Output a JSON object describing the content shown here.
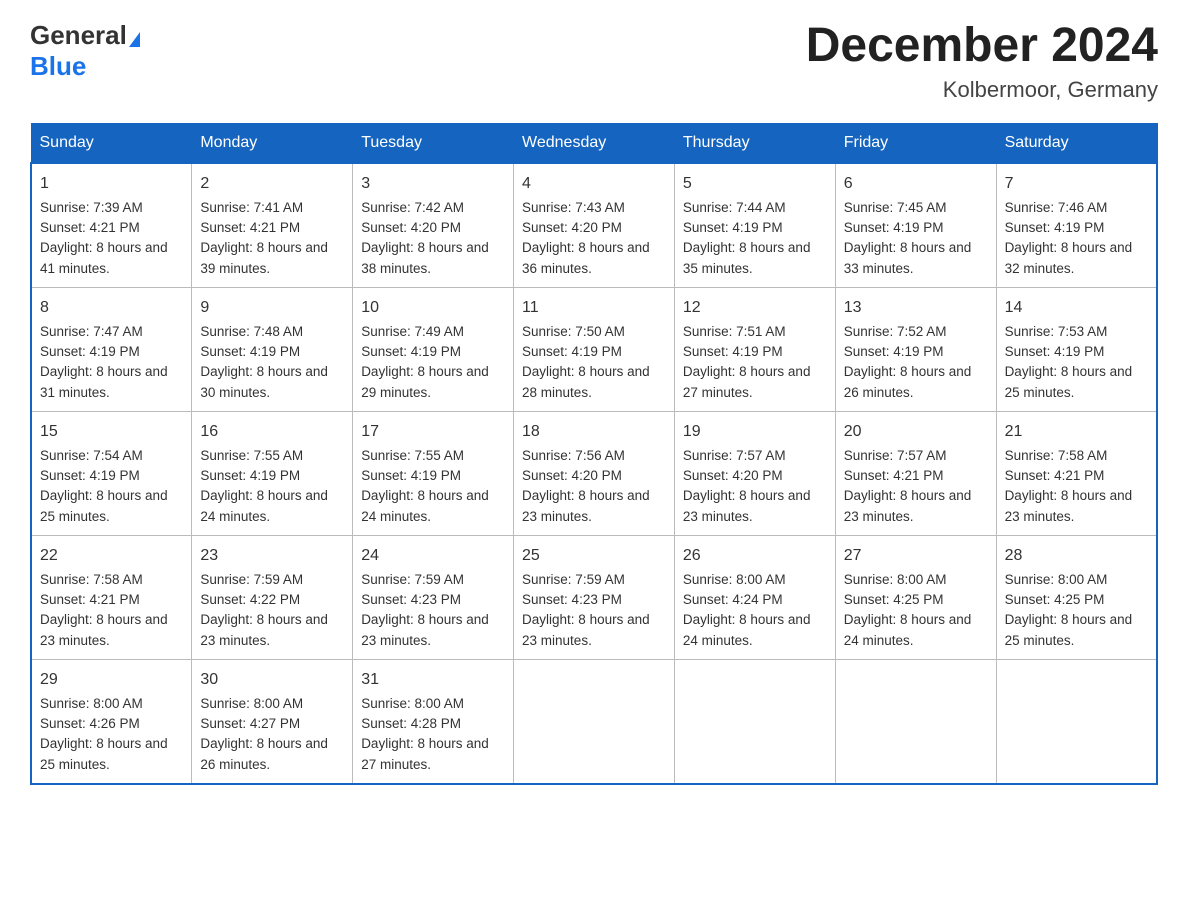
{
  "header": {
    "logo_general": "General",
    "logo_blue": "Blue",
    "title": "December 2024",
    "subtitle": "Kolbermoor, Germany"
  },
  "days_of_week": [
    "Sunday",
    "Monday",
    "Tuesday",
    "Wednesday",
    "Thursday",
    "Friday",
    "Saturday"
  ],
  "weeks": [
    [
      {
        "day": "1",
        "sunrise": "7:39 AM",
        "sunset": "4:21 PM",
        "daylight": "8 hours and 41 minutes."
      },
      {
        "day": "2",
        "sunrise": "7:41 AM",
        "sunset": "4:21 PM",
        "daylight": "8 hours and 39 minutes."
      },
      {
        "day": "3",
        "sunrise": "7:42 AM",
        "sunset": "4:20 PM",
        "daylight": "8 hours and 38 minutes."
      },
      {
        "day": "4",
        "sunrise": "7:43 AM",
        "sunset": "4:20 PM",
        "daylight": "8 hours and 36 minutes."
      },
      {
        "day": "5",
        "sunrise": "7:44 AM",
        "sunset": "4:19 PM",
        "daylight": "8 hours and 35 minutes."
      },
      {
        "day": "6",
        "sunrise": "7:45 AM",
        "sunset": "4:19 PM",
        "daylight": "8 hours and 33 minutes."
      },
      {
        "day": "7",
        "sunrise": "7:46 AM",
        "sunset": "4:19 PM",
        "daylight": "8 hours and 32 minutes."
      }
    ],
    [
      {
        "day": "8",
        "sunrise": "7:47 AM",
        "sunset": "4:19 PM",
        "daylight": "8 hours and 31 minutes."
      },
      {
        "day": "9",
        "sunrise": "7:48 AM",
        "sunset": "4:19 PM",
        "daylight": "8 hours and 30 minutes."
      },
      {
        "day": "10",
        "sunrise": "7:49 AM",
        "sunset": "4:19 PM",
        "daylight": "8 hours and 29 minutes."
      },
      {
        "day": "11",
        "sunrise": "7:50 AM",
        "sunset": "4:19 PM",
        "daylight": "8 hours and 28 minutes."
      },
      {
        "day": "12",
        "sunrise": "7:51 AM",
        "sunset": "4:19 PM",
        "daylight": "8 hours and 27 minutes."
      },
      {
        "day": "13",
        "sunrise": "7:52 AM",
        "sunset": "4:19 PM",
        "daylight": "8 hours and 26 minutes."
      },
      {
        "day": "14",
        "sunrise": "7:53 AM",
        "sunset": "4:19 PM",
        "daylight": "8 hours and 25 minutes."
      }
    ],
    [
      {
        "day": "15",
        "sunrise": "7:54 AM",
        "sunset": "4:19 PM",
        "daylight": "8 hours and 25 minutes."
      },
      {
        "day": "16",
        "sunrise": "7:55 AM",
        "sunset": "4:19 PM",
        "daylight": "8 hours and 24 minutes."
      },
      {
        "day": "17",
        "sunrise": "7:55 AM",
        "sunset": "4:19 PM",
        "daylight": "8 hours and 24 minutes."
      },
      {
        "day": "18",
        "sunrise": "7:56 AM",
        "sunset": "4:20 PM",
        "daylight": "8 hours and 23 minutes."
      },
      {
        "day": "19",
        "sunrise": "7:57 AM",
        "sunset": "4:20 PM",
        "daylight": "8 hours and 23 minutes."
      },
      {
        "day": "20",
        "sunrise": "7:57 AM",
        "sunset": "4:21 PM",
        "daylight": "8 hours and 23 minutes."
      },
      {
        "day": "21",
        "sunrise": "7:58 AM",
        "sunset": "4:21 PM",
        "daylight": "8 hours and 23 minutes."
      }
    ],
    [
      {
        "day": "22",
        "sunrise": "7:58 AM",
        "sunset": "4:21 PM",
        "daylight": "8 hours and 23 minutes."
      },
      {
        "day": "23",
        "sunrise": "7:59 AM",
        "sunset": "4:22 PM",
        "daylight": "8 hours and 23 minutes."
      },
      {
        "day": "24",
        "sunrise": "7:59 AM",
        "sunset": "4:23 PM",
        "daylight": "8 hours and 23 minutes."
      },
      {
        "day": "25",
        "sunrise": "7:59 AM",
        "sunset": "4:23 PM",
        "daylight": "8 hours and 23 minutes."
      },
      {
        "day": "26",
        "sunrise": "8:00 AM",
        "sunset": "4:24 PM",
        "daylight": "8 hours and 24 minutes."
      },
      {
        "day": "27",
        "sunrise": "8:00 AM",
        "sunset": "4:25 PM",
        "daylight": "8 hours and 24 minutes."
      },
      {
        "day": "28",
        "sunrise": "8:00 AM",
        "sunset": "4:25 PM",
        "daylight": "8 hours and 25 minutes."
      }
    ],
    [
      {
        "day": "29",
        "sunrise": "8:00 AM",
        "sunset": "4:26 PM",
        "daylight": "8 hours and 25 minutes."
      },
      {
        "day": "30",
        "sunrise": "8:00 AM",
        "sunset": "4:27 PM",
        "daylight": "8 hours and 26 minutes."
      },
      {
        "day": "31",
        "sunrise": "8:00 AM",
        "sunset": "4:28 PM",
        "daylight": "8 hours and 27 minutes."
      },
      null,
      null,
      null,
      null
    ]
  ],
  "labels": {
    "sunrise_prefix": "Sunrise: ",
    "sunset_prefix": "Sunset: ",
    "daylight_prefix": "Daylight: "
  }
}
